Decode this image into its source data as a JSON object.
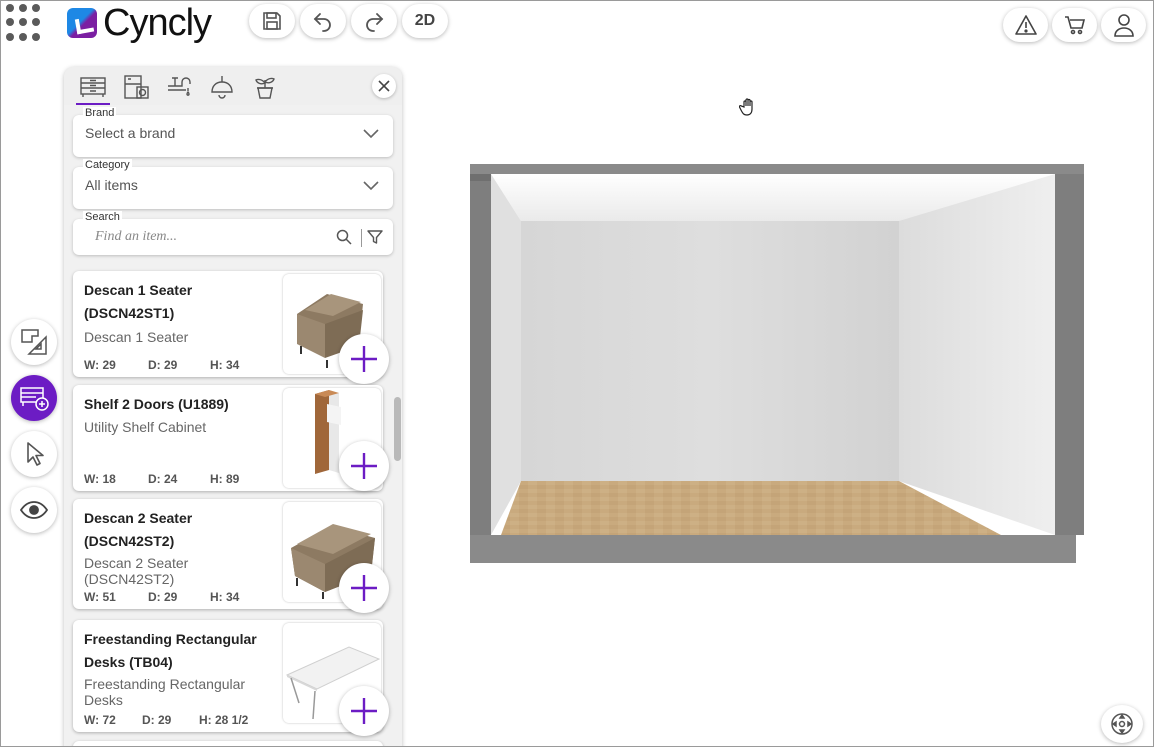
{
  "app": {
    "name": "Cyncly"
  },
  "toolbar": {
    "view_mode_label": "2D"
  },
  "filters": {
    "brand": {
      "label": "Brand",
      "value": "Select a brand"
    },
    "category": {
      "label": "Category",
      "value": "All items"
    },
    "search": {
      "label": "Search",
      "placeholder": "Find an item..."
    }
  },
  "catalog_tabs": [
    "furniture-tab",
    "appliances-tab",
    "plumbing-tab",
    "lighting-tab",
    "decor-tab"
  ],
  "items": [
    {
      "title": "Descan 1 Seater (DSCN42ST1)",
      "description": "Descan 1 Seater",
      "w": "W: 29",
      "d": "D: 29",
      "h": "H: 34"
    },
    {
      "title": "Shelf 2 Doors (U1889)",
      "description": "Utility Shelf Cabinet",
      "w": "W: 18",
      "d": "D: 24",
      "h": "H: 89"
    },
    {
      "title": "Descan 2 Seater (DSCN42ST2)",
      "description": "Descan 2 Seater (DSCN42ST2)",
      "w": "W: 51",
      "d": "D: 29",
      "h": "H: 34"
    },
    {
      "title": "Freestanding Rectangular Desks (TB04)",
      "description": "Freestanding Rectangular Desks",
      "w": "W: 72",
      "d": "D: 29",
      "h": "H: 28 1/2"
    }
  ],
  "colors": {
    "accent": "#6c1cc4",
    "wall": "#d9d9d9",
    "floor": "#c8a97e"
  }
}
